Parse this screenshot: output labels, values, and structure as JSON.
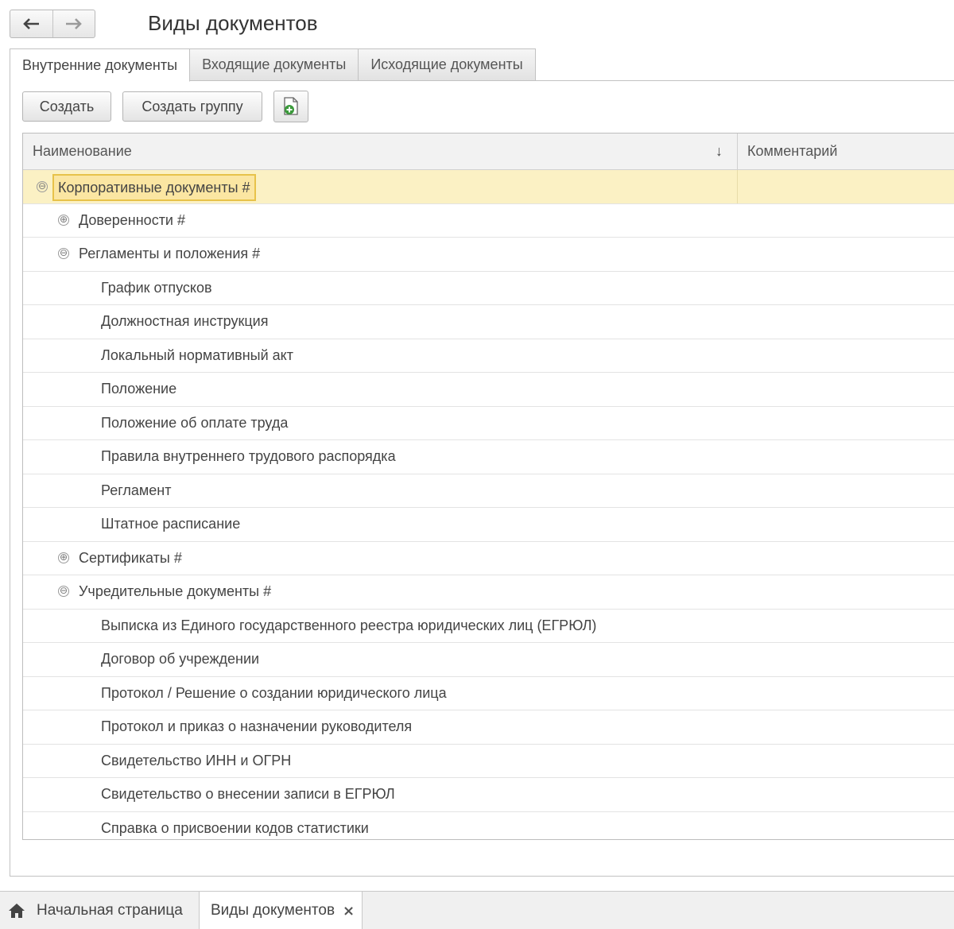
{
  "page": {
    "title": "Виды документов"
  },
  "nav": {
    "back_icon": "arrow-left-icon",
    "forward_icon": "arrow-right-icon"
  },
  "tabs": [
    {
      "label": "Внутренние документы",
      "active": true
    },
    {
      "label": "Входящие документы",
      "active": false
    },
    {
      "label": "Исходящие документы",
      "active": false
    }
  ],
  "toolbar": {
    "create_label": "Создать",
    "create_group_label": "Создать группу",
    "add_icon": "add-document-icon"
  },
  "table": {
    "columns": {
      "name": "Наименование",
      "comment": "Комментарий",
      "sort_indicator": "↓"
    },
    "rows": [
      {
        "level": 0,
        "expanded": true,
        "toggle": "⊖",
        "name": "Корпоративные документы #",
        "selected": true
      },
      {
        "level": 1,
        "expanded": false,
        "toggle": "⊕",
        "name": "Доверенности #"
      },
      {
        "level": 1,
        "expanded": true,
        "toggle": "⊖",
        "name": "Регламенты и положения #"
      },
      {
        "level": 2,
        "name": "График отпусков"
      },
      {
        "level": 2,
        "name": "Должностная инструкция"
      },
      {
        "level": 2,
        "name": "Локальный нормативный акт"
      },
      {
        "level": 2,
        "name": "Положение"
      },
      {
        "level": 2,
        "name": "Положение об оплате труда"
      },
      {
        "level": 2,
        "name": "Правила внутреннего трудового распорядка"
      },
      {
        "level": 2,
        "name": "Регламент"
      },
      {
        "level": 2,
        "name": "Штатное расписание"
      },
      {
        "level": 1,
        "expanded": false,
        "toggle": "⊕",
        "name": "Сертификаты #"
      },
      {
        "level": 1,
        "expanded": true,
        "toggle": "⊖",
        "name": "Учредительные документы #"
      },
      {
        "level": 2,
        "name": "Выписка из Единого государственного реестра юридических лиц (ЕГРЮЛ)"
      },
      {
        "level": 2,
        "name": "Договор об учреждении"
      },
      {
        "level": 2,
        "name": "Протокол / Решение о создании юридического лица"
      },
      {
        "level": 2,
        "name": "Протокол и приказ о назначении руководителя"
      },
      {
        "level": 2,
        "name": "Свидетельство ИНН и ОГРН"
      },
      {
        "level": 2,
        "name": "Свидетельство о внесении записи в ЕГРЮЛ"
      },
      {
        "level": 2,
        "name": "Справка о присвоении кодов статистики"
      }
    ]
  },
  "taskbar": {
    "home_label": "Начальная страница",
    "home_icon": "home-icon",
    "open_tab_label": "Виды документов",
    "close_glyph": "×"
  },
  "colors": {
    "selected_row": "#fbf1c4",
    "selected_cell_border": "#e7c24a",
    "accent_green": "#3b9a3b"
  }
}
